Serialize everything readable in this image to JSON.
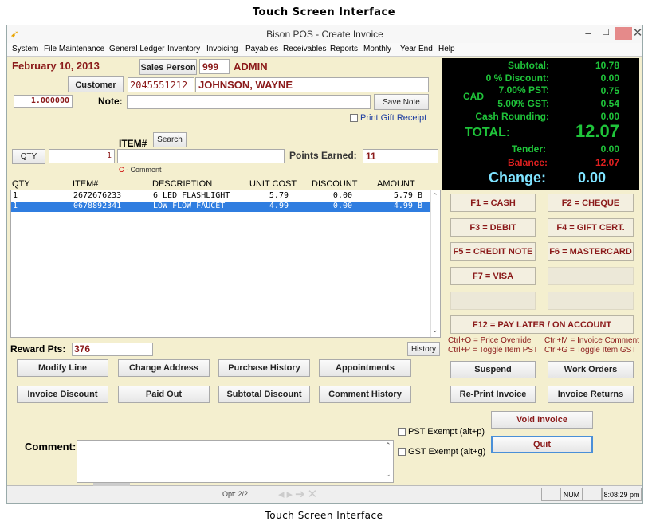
{
  "captions": {
    "top": "Touch Screen Interface",
    "bottom": "Touch Screen Interface"
  },
  "window": {
    "title": "Bison POS - Create Invoice"
  },
  "menu": [
    "System",
    "File Maintenance",
    "General Ledger",
    "Inventory",
    "Invoicing",
    "Payables",
    "Receivables",
    "Reports",
    "Monthly",
    "Year End",
    "Help"
  ],
  "header": {
    "date": "February 10, 2013",
    "salesperson_label": "Sales Person",
    "salesperson_id": "999",
    "salesperson_name": "ADMIN",
    "customer_label": "Customer",
    "customer_phone": "2045551212",
    "customer_name": "JOHNSON, WAYNE",
    "rate": "1.000000",
    "note_label": "Note:",
    "note_value": "",
    "save_note": "Save Note",
    "print_gift_receipt": "Print Gift Receipt",
    "item_label": "ITEM#",
    "search": "Search",
    "qty_label": "QTY",
    "qty_value": "1",
    "item_value": "",
    "points_label": "Points Earned:",
    "points_value": "11",
    "comment_hint": "C - Comment"
  },
  "table": {
    "columns": [
      "QTY",
      "ITEM#",
      "DESCRIPTION",
      "UNIT COST",
      "DISCOUNT",
      "AMOUNT"
    ],
    "rows": [
      {
        "qty": "1",
        "item": "2672676233",
        "desc": "6 LED FLASHLIGHT",
        "cost": "5.79",
        "disc": "0.00",
        "amount": "5.79 B"
      },
      {
        "qty": "1",
        "item": "0678892341",
        "desc": "LOW FLOW FAUCET",
        "cost": "4.99",
        "disc": "0.00",
        "amount": "4.99 B"
      }
    ]
  },
  "totals": {
    "subtotal_label": "Subtotal:",
    "subtotal": "10.78",
    "discount_label": "0 % Discount:",
    "discount": "0.00",
    "currency": "CAD",
    "pst_label": "7.00% PST:",
    "pst": "0.75",
    "gst_label": "5.00% GST:",
    "gst": "0.54",
    "rounding_label": "Cash Rounding:",
    "rounding": "0.00",
    "total_label": "TOTAL:",
    "total": "12.07",
    "tender_label": "Tender:",
    "tender": "0.00",
    "balance_label": "Balance:",
    "balance": "12.07",
    "change_label": "Change:",
    "change": "0.00",
    "colors": {
      "green": "#1fc43a",
      "red": "#e02020",
      "cyan": "#7fe3ff"
    }
  },
  "fkeys": {
    "f1": "F1 = CASH",
    "f2": "F2 = CHEQUE",
    "f3": "F3 = DEBIT",
    "f4": "F4 = GIFT CERT.",
    "f5": "F5 = CREDIT NOTE",
    "f6": "F6 = MASTERCARD",
    "f7": "F7 = VISA",
    "f12": "F12 = PAY LATER / ON ACCOUNT"
  },
  "shortcuts": {
    "a": "Ctrl+O = Price Override",
    "b": "Ctrl+M = Invoice Comment",
    "c": "Ctrl+P = Toggle Item PST",
    "d": "Ctrl+G = Toggle Item GST"
  },
  "reward": {
    "label": "Reward Pts:",
    "value": "376",
    "history": "History"
  },
  "buttons": {
    "modify_line": "Modify Line",
    "change_address": "Change Address",
    "purchase_history": "Purchase History",
    "appointments": "Appointments",
    "invoice_discount": "Invoice Discount",
    "paid_out": "Paid Out",
    "subtotal_discount": "Subtotal Discount",
    "comment_history": "Comment History",
    "suspend": "Suspend",
    "work_orders": "Work Orders",
    "reprint_invoice": "Re-Print Invoice",
    "invoice_returns": "Invoice Returns",
    "void_invoice": "Void Invoice",
    "quit": "Quit"
  },
  "comment": {
    "label": "Comment:",
    "value": ""
  },
  "exempt": {
    "pst": "PST Exempt (alt+p)",
    "gst": "GST Exempt (alt+g)"
  },
  "status": {
    "opt": "Opt: 2/2",
    "num": "NUM",
    "time": "8:08:29 pm"
  }
}
